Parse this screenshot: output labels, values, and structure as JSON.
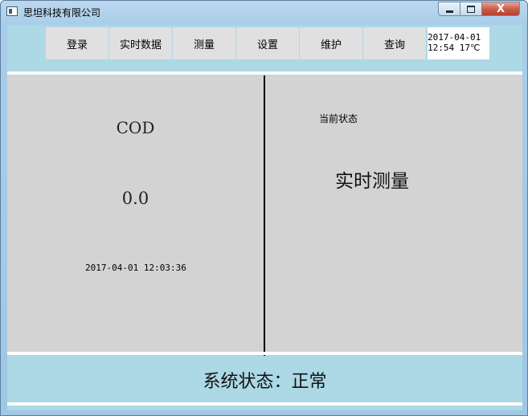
{
  "window": {
    "title": "思坦科技有限公司",
    "close_glyph": "X"
  },
  "menu": {
    "items": [
      {
        "label": "登录"
      },
      {
        "label": "实时数据"
      },
      {
        "label": "测量"
      },
      {
        "label": "设置"
      },
      {
        "label": "维护"
      },
      {
        "label": "查询"
      }
    ],
    "clock_date": "2017-04-01",
    "clock_time_temp": "12:54 17℃"
  },
  "measurement": {
    "parameter": "COD",
    "value": "0.0",
    "timestamp": "2017-04-01 12:03:36"
  },
  "status": {
    "caption": "当前状态",
    "current": "实时测量",
    "system": "系统状态：正常"
  },
  "colors": {
    "client_bg": "#add8e6",
    "panel_bg": "#d3d3d3",
    "button_bg": "#e0e0e0"
  }
}
